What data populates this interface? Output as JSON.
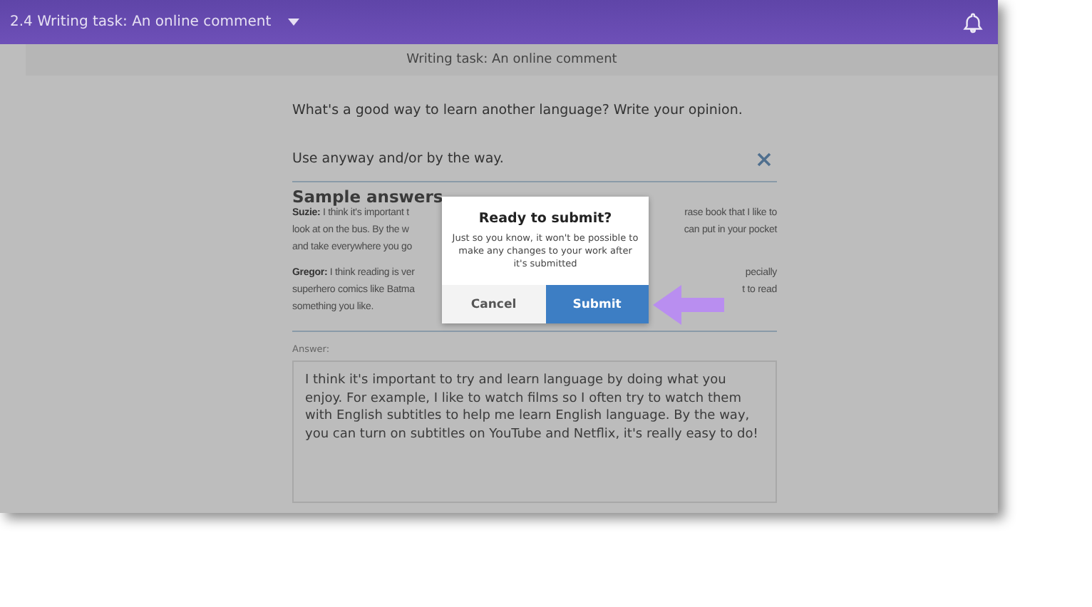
{
  "top_bar": {
    "title": "2.4 Writing task: An online comment"
  },
  "sub_header": {
    "title": "Writing task: An online comment"
  },
  "task": {
    "question": "What's a good way to learn another language? Write your opinion.",
    "hint": "Use anyway and/or by the way."
  },
  "samples": {
    "heading": "Sample answers",
    "paragraphs": [
      {
        "lines": [
          {
            "left": "**Suzie:** I think it's important t",
            "right": "rase book that I like to"
          },
          {
            "left": "look at on the bus. By the w",
            "right": "can put in your pocket"
          },
          {
            "left": "and take everywhere you go"
          }
        ]
      },
      {
        "lines": [
          {
            "left": "**Gregor:** I think reading is ver",
            "right": "pecially"
          },
          {
            "left": "superhero comics like Batma",
            "right": "t to read"
          },
          {
            "left": "something you like."
          }
        ]
      }
    ]
  },
  "answer": {
    "label": "Answer:",
    "value": "I think it's important to try and learn language by doing what you enjoy. For example, I like to watch films so I often try to watch them with English subtitles to help me learn English language. By the way, you can turn on subtitles on YouTube and Netflix, it's really easy to do!"
  },
  "dialog": {
    "title": "Ready to submit?",
    "message": "Just so you know, it won't be possible to make any changes to your work after it's submitted",
    "buttons": [
      {
        "label": "Cancel",
        "kind": "secondary"
      },
      {
        "label": "Submit",
        "kind": "primary"
      }
    ]
  }
}
